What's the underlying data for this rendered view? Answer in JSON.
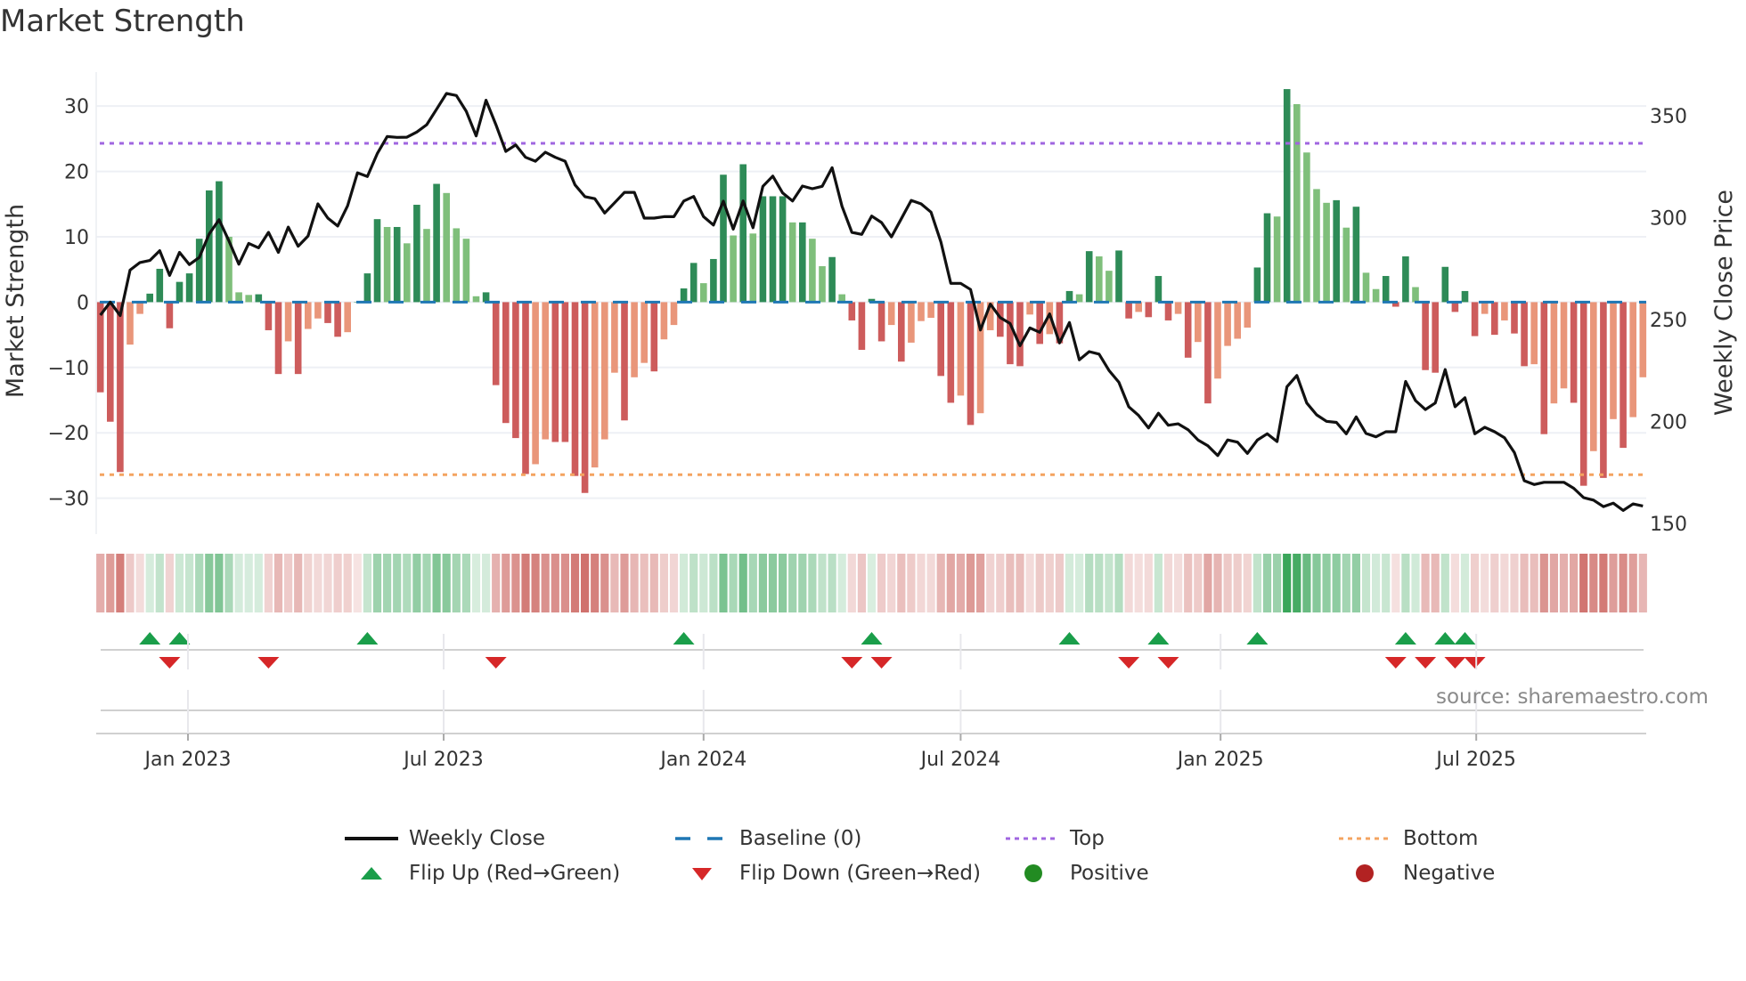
{
  "title": "Market Strength",
  "source": "source: sharemaestro.com",
  "legend": {
    "weekly_close": "Weekly Close",
    "baseline": "Baseline (0)",
    "top": "Top",
    "bottom": "Bottom",
    "flip_up": "Flip Up (Red→Green)",
    "flip_down": "Flip Down (Green→Red)",
    "positive": "Positive",
    "negative": "Negative"
  },
  "colors": {
    "pos_strong": "#2e8b57",
    "pos_weak": "#7fbf7b",
    "neg_strong": "#cd5c5c",
    "neg_weak": "#e9967a",
    "baseline": "#1f77b4",
    "top": "#a066e0",
    "bottom": "#f4a460",
    "flip_up": "#1a9e4a",
    "flip_down": "#d62728",
    "positive_dot": "#228b22",
    "negative_dot": "#b22222",
    "price": "#111111"
  },
  "chart_data": {
    "type": "bar+line",
    "title": "Market Strength",
    "ylabel": "Market Strength",
    "y2label": "Weekly Close Price",
    "start_date": "2022-10-31",
    "frequency": "weekly",
    "ylim": [
      -35.5,
      35.2
    ],
    "y2lim": [
      144.8,
      371.4
    ],
    "y_ticks": [
      30,
      20,
      10,
      0,
      -10,
      -20,
      -30
    ],
    "y_tick_labels": [
      "30",
      "20",
      "10",
      "0",
      "−10",
      "−20",
      "−30"
    ],
    "y2_ticks": [
      350,
      300,
      250,
      200,
      150
    ],
    "y2_tick_labels": [
      "350",
      "300",
      "250",
      "200",
      "150"
    ],
    "x_ticks": [
      {
        "date": "2023-01-01",
        "label": "Jan 2023"
      },
      {
        "date": "2023-07-01",
        "label": "Jul 2023"
      },
      {
        "date": "2024-01-01",
        "label": "Jan 2024"
      },
      {
        "date": "2024-07-01",
        "label": "Jul 2024"
      },
      {
        "date": "2025-01-01",
        "label": "Jan 2025"
      },
      {
        "date": "2025-07-01",
        "label": "Jul 2025"
      }
    ],
    "top_level": 24.3,
    "bottom_level": -26.4,
    "baseline": 0,
    "grid": true,
    "legend_position": "bottom",
    "strength": [
      -13.8,
      -18.3,
      -26,
      -6.5,
      -1.8,
      1.3,
      5.1,
      -4,
      3.1,
      4.4,
      9.7,
      17.1,
      18.5,
      10,
      1.5,
      1.1,
      1.2,
      -4.3,
      -11,
      -6,
      -11,
      -4.1,
      -2.5,
      -3.2,
      -5.3,
      -4.6,
      0,
      4.4,
      12.7,
      11.5,
      11.5,
      9,
      14.9,
      11.2,
      18.1,
      16.7,
      11.3,
      9.7,
      0.9,
      1.5,
      -12.7,
      -18.5,
      -20.8,
      -26.3,
      -24.8,
      -21,
      -21.4,
      -21.4,
      -26.6,
      -29.2,
      -25.3,
      -21,
      -10.8,
      -18.1,
      -11.5,
      -9.3,
      -10.6,
      -5.7,
      -3.5,
      2.1,
      6,
      2.9,
      6.6,
      19.5,
      10.2,
      21.1,
      10.5,
      16.2,
      16.2,
      16.2,
      12.2,
      12.2,
      9.7,
      5.5,
      6.9,
      1.2,
      -2.8,
      -7.3,
      0.5,
      -6,
      -3.5,
      -9.1,
      -6.2,
      -2.9,
      -2.4,
      -11.3,
      -15.4,
      -14.3,
      -18.8,
      -17,
      -4.3,
      -5.3,
      -9.5,
      -9.8,
      -1.9,
      -6.4,
      -4.9,
      -6.3,
      1.7,
      1.2,
      7.8,
      7,
      4.8,
      7.9,
      -2.5,
      -1.5,
      -2.3,
      4,
      -2.8,
      -1.8,
      -8.5,
      -6.1,
      -15.5,
      -11.7,
      -6.7,
      -5.6,
      -3.9,
      5.3,
      13.6,
      13.1,
      32.6,
      30.3,
      22.9,
      17.3,
      15.2,
      15.6,
      11.4,
      14.6,
      4.5,
      2,
      4,
      -0.7,
      7,
      2.3,
      -10.4,
      -10.8,
      5.4,
      -1.5,
      1.7,
      -5.2,
      -1.8,
      -5,
      -2.8,
      -4.8,
      -9.8,
      -9.5,
      -20.2,
      -15.5,
      -13.2,
      -15.4,
      -28.1,
      -22.8,
      -26.9,
      -17.9,
      -22.3,
      -17.6,
      -11.5
    ],
    "weekly_close": [
      252.2,
      258.6,
      252,
      274.3,
      278,
      279,
      283.8,
      271.7,
      283,
      277,
      280.5,
      292,
      299,
      288.6,
      277.2,
      287.4,
      285.2,
      292.8,
      283,
      295.4,
      286,
      291,
      306.8,
      299.8,
      295.9,
      305.8,
      322,
      320.2,
      331.4,
      339.8,
      339.4,
      339.5,
      342,
      345.6,
      353.2,
      360.9,
      359.9,
      352.2,
      340.1,
      357.6,
      345.6,
      332.5,
      335.7,
      329.6,
      327.7,
      332.1,
      329.6,
      327.7,
      316.1,
      310.3,
      309.3,
      302.3,
      307.3,
      312.4,
      312.4,
      299.8,
      299.8,
      300.5,
      300.5,
      308.2,
      310.4,
      300.5,
      296.4,
      308.1,
      294.4,
      308.2,
      295.1,
      315.4,
      320.4,
      312.1,
      308.2,
      315.5,
      314.2,
      315.4,
      324.5,
      305.6,
      292.8,
      291.8,
      300.8,
      297.6,
      290.6,
      299.5,
      308.5,
      306.8,
      302.7,
      288.1,
      267.8,
      267.8,
      264.8,
      244.9,
      257.6,
      251,
      248.1,
      237.2,
      245.9,
      243.8,
      252.8,
      238.6,
      248.6,
      230.3,
      234.3,
      233.1,
      225.1,
      219.3,
      207.3,
      203,
      196.9,
      204.1,
      198.2,
      198.9,
      196,
      191,
      188.1,
      183.3,
      191,
      189.9,
      184.4,
      190.9,
      194,
      190.2,
      217.1,
      222.6,
      209.1,
      203.3,
      200.1,
      199.6,
      194,
      202.3,
      194.2,
      192.5,
      195,
      195,
      219.7,
      210.3,
      205.9,
      209.1,
      225.5,
      207.3,
      211.7,
      194,
      197.2,
      195,
      192.1,
      184.8,
      171,
      169.1,
      170.2,
      170.2,
      170.2,
      167.3,
      162.7,
      161.5,
      158.3,
      160,
      156.4,
      159.6,
      158.6
    ]
  }
}
